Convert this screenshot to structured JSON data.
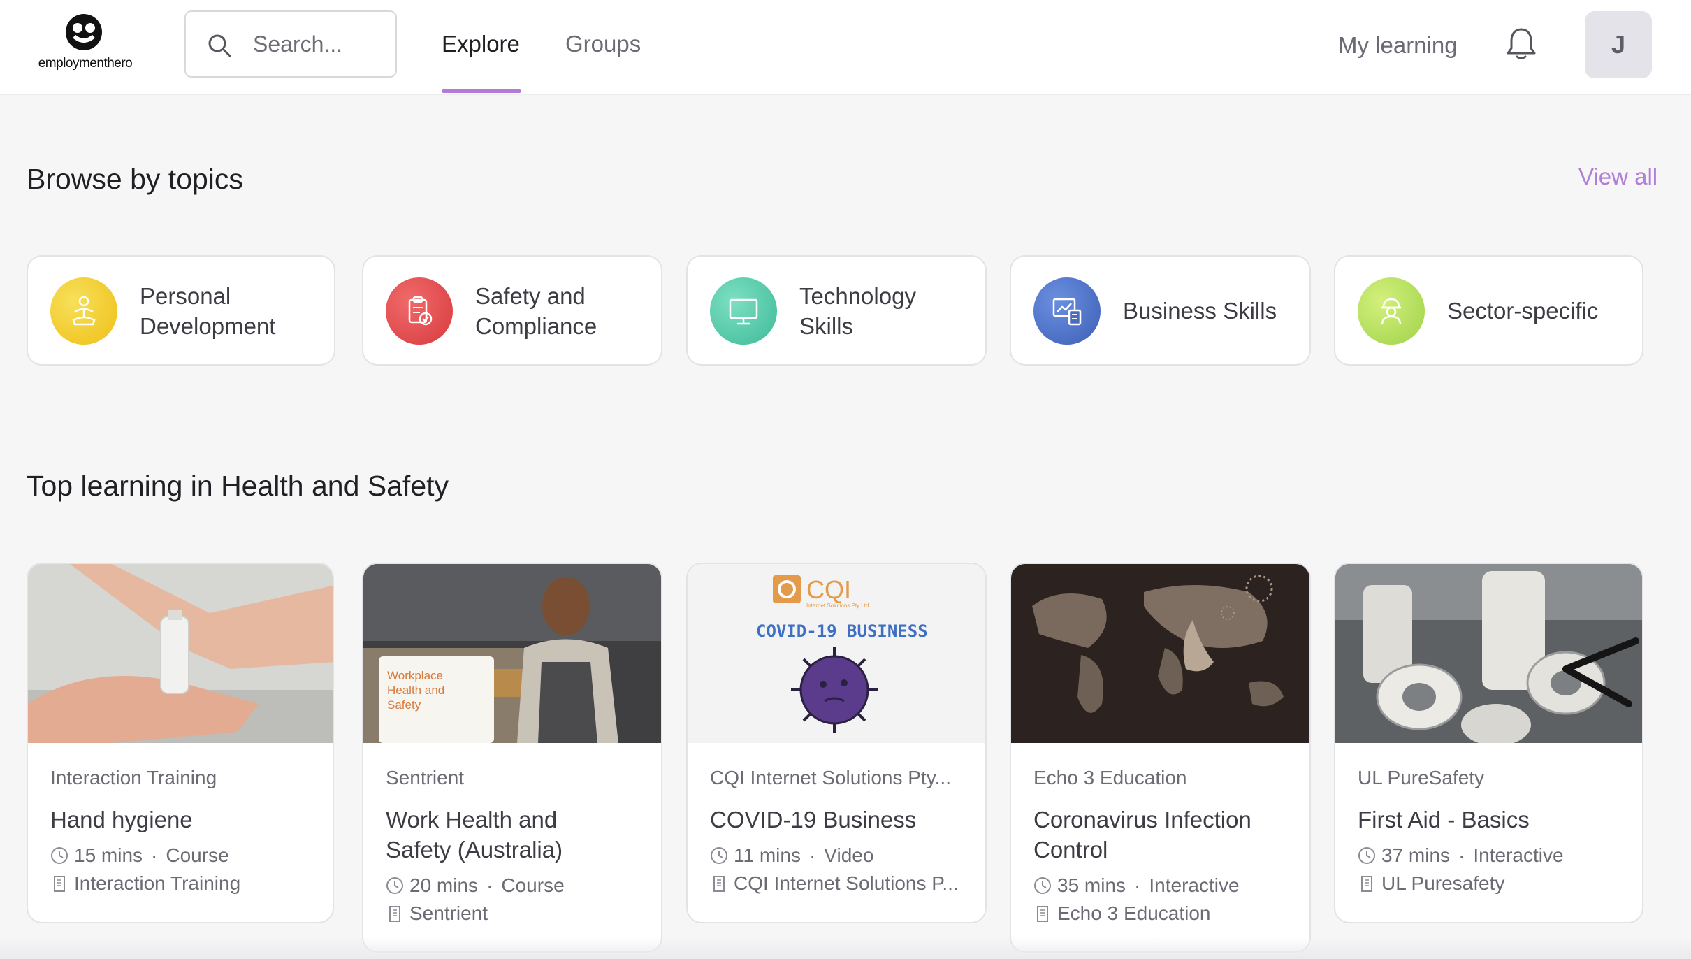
{
  "header": {
    "logo_text": "employmenthero",
    "search_placeholder": "Search...",
    "tabs": [
      {
        "label": "Explore",
        "active": true
      },
      {
        "label": "Groups",
        "active": false
      }
    ],
    "my_learning": "My learning",
    "avatar_initial": "J",
    "accent_color": "#b27bd6"
  },
  "browse": {
    "title": "Browse by topics",
    "view_all": "View all",
    "topics": [
      {
        "line1": "Personal",
        "line2": "Development",
        "icon": "meditation-icon",
        "color": "#f3cc2a"
      },
      {
        "line1": "Safety and",
        "line2": "Compliance",
        "icon": "clipboard-check-icon",
        "color": "#e24f4f"
      },
      {
        "line1": "Technology",
        "line2": "Skills",
        "icon": "monitor-icon",
        "color": "#58c9a8"
      },
      {
        "line1": "Business Skills",
        "line2": "",
        "icon": "business-chart-icon",
        "color": "#4f6fc6"
      },
      {
        "line1": "Sector-specific",
        "line2": "",
        "icon": "worker-icon",
        "color": "#b8e05c"
      }
    ]
  },
  "top": {
    "title": "Top learning in Health and Safety",
    "courses": [
      {
        "provider": "Interaction Training",
        "title1": "Hand hygiene",
        "title2": "",
        "duration": "15 mins",
        "type": "Course",
        "org": "Interaction Training"
      },
      {
        "provider": "Sentrient",
        "title1": "Work Health and",
        "title2": "Safety (Australia)",
        "duration": "20 mins",
        "type": "Course",
        "org": "Sentrient",
        "image_text": [
          "Workplace",
          "Health and",
          "Safety"
        ]
      },
      {
        "provider": "CQI Internet Solutions Pty...",
        "title1": "COVID-19 Business",
        "title2": "",
        "duration": "11 mins",
        "type": "Video",
        "org": "CQI Internet Solutions P...",
        "image_logo": "CQI",
        "image_sub": "Internet Solutions Pty Ltd",
        "image_text": "COVID-19 BUSINESS"
      },
      {
        "provider": "Echo 3 Education",
        "title1": "Coronavirus Infection",
        "title2": "Control",
        "duration": "35 mins",
        "type": "Interactive",
        "org": "Echo 3 Education"
      },
      {
        "provider": "UL PureSafety",
        "title1": "First Aid - Basics",
        "title2": "",
        "duration": "37 mins",
        "type": "Interactive",
        "org": "UL Puresafety"
      }
    ]
  }
}
